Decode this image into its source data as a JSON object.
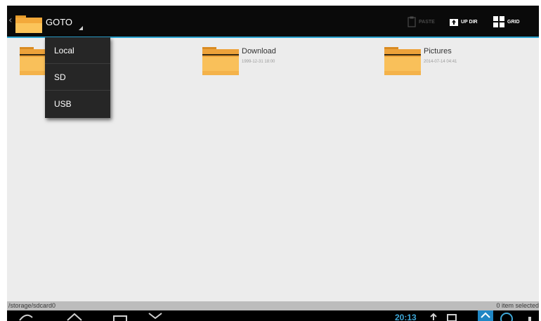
{
  "action_bar": {
    "goto_label": "GOTO",
    "paste_label": "PASTE",
    "updir_label": "UP DIR",
    "grid_label": "GRID",
    "accent_color": "#2aa3cf"
  },
  "goto_menu": {
    "items": [
      {
        "label": "Local"
      },
      {
        "label": "SD"
      },
      {
        "label": "USB"
      }
    ]
  },
  "files": [
    {
      "name": "",
      "date": "",
      "icon": "folder-icon"
    },
    {
      "name": "Download",
      "date": "1999-12-31 18:00",
      "icon": "folder-icon"
    },
    {
      "name": "Pictures",
      "date": "2014-07-14 04:41",
      "icon": "folder-icon"
    }
  ],
  "status": {
    "path": "/storage/sdcard0",
    "selection": "0 item selected"
  },
  "system_bar": {
    "clock": "20:13"
  }
}
